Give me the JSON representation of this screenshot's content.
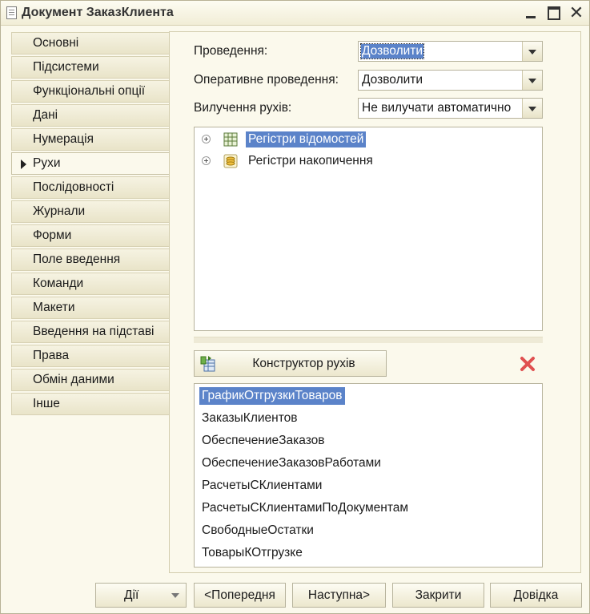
{
  "window": {
    "title": "Документ ЗаказКлиента"
  },
  "tabs": [
    {
      "label": "Основні"
    },
    {
      "label": "Підсистеми"
    },
    {
      "label": "Функціональні опції"
    },
    {
      "label": "Дані"
    },
    {
      "label": "Нумерація"
    },
    {
      "label": "Рухи",
      "active": true
    },
    {
      "label": "Послідовності"
    },
    {
      "label": "Журнали"
    },
    {
      "label": "Форми"
    },
    {
      "label": "Поле введення"
    },
    {
      "label": "Команди"
    },
    {
      "label": "Макети"
    },
    {
      "label": "Введення на підставі"
    },
    {
      "label": "Права"
    },
    {
      "label": "Обмін даними"
    },
    {
      "label": "Інше"
    }
  ],
  "fields": {
    "posting": {
      "label": "Проведення:",
      "value": "Дозволити"
    },
    "realtime_posting": {
      "label": "Оперативне проведення:",
      "value": "Дозволити"
    },
    "movement_deletion": {
      "label": "Вилучення рухів:",
      "value": "Не вилучати автоматично"
    }
  },
  "registers_tree": [
    {
      "label": "Регістри відомостей",
      "icon": "information-register-icon",
      "selected": true
    },
    {
      "label": "Регістри накопичення",
      "icon": "accumulation-register-icon",
      "selected": false
    }
  ],
  "constructor_button": {
    "label": "Конструктор рухів"
  },
  "movements_list": [
    {
      "label": "ГрафикОтгрузкиТоваров",
      "selected": true
    },
    {
      "label": "ЗаказыКлиентов"
    },
    {
      "label": "ОбеспечениеЗаказов"
    },
    {
      "label": "ОбеспечениеЗаказовРаботами"
    },
    {
      "label": "РасчетыСКлиентами"
    },
    {
      "label": "РасчетыСКлиентамиПоДокументам"
    },
    {
      "label": "СвободныеОстатки"
    },
    {
      "label": "ТоварыКОтгрузке"
    }
  ],
  "buttons": {
    "actions": "Дії",
    "previous": "<Попередня",
    "next": "Наступна>",
    "close": "Закрити",
    "help": "Довідка"
  },
  "colors": {
    "selection": "#5b83c9",
    "background": "#fbf9ec",
    "delete_icon": "#e05050"
  }
}
